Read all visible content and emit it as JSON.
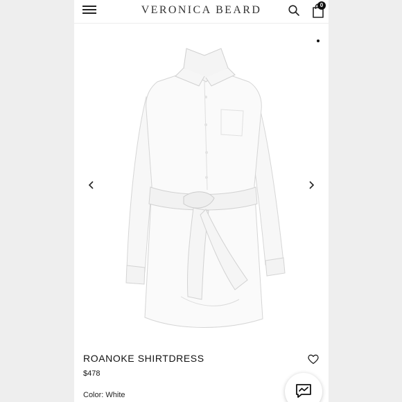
{
  "header": {
    "brand": "VERONICA BEARD",
    "bag_count": "0",
    "icons": [
      "menu-icon",
      "search-icon",
      "shopping-bag-icon"
    ]
  },
  "gallery": {
    "image": "white-shirtdress-product-photo",
    "prev_icon": "chevron-left-icon",
    "next_icon": "chevron-right-icon"
  },
  "product": {
    "name": "ROANOKE SHIRTDRESS",
    "price": "$478",
    "color_label": "Color:",
    "color_value": "White",
    "wishlist_icon": "heart-icon"
  },
  "chat": {
    "icon": "chat-icon"
  }
}
